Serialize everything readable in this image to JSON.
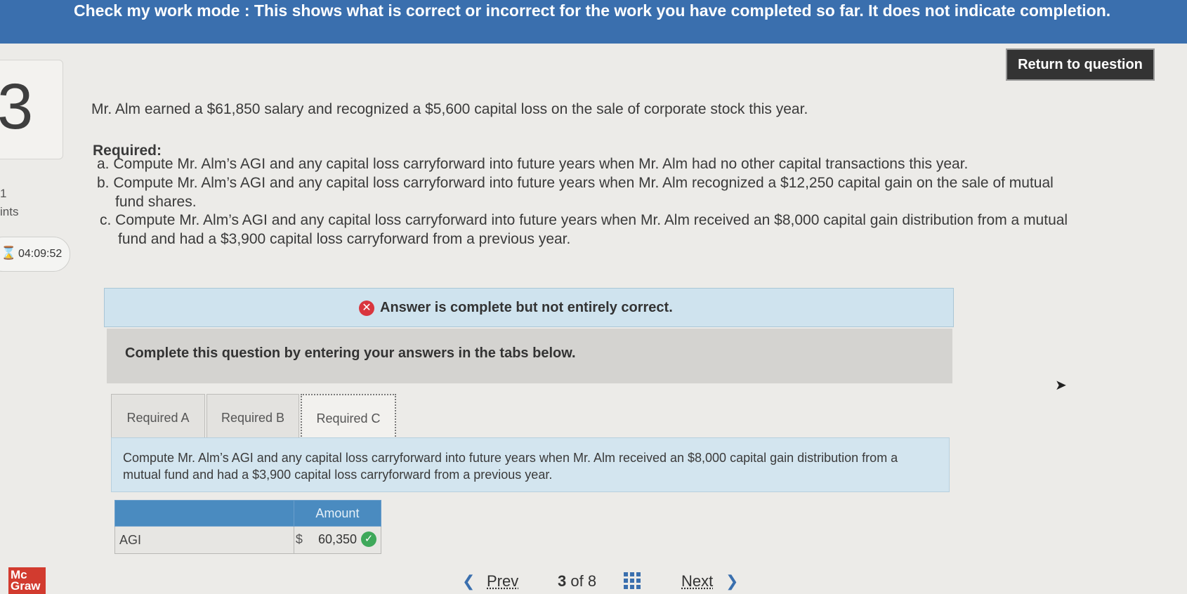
{
  "banner": {
    "text": "Check my work mode : This shows what is correct or incorrect for the work you have completed so far. It does not indicate completion."
  },
  "sidebar": {
    "question_number": "3",
    "points_value": "1",
    "points_label": "ints",
    "timer": "04:09:52"
  },
  "return_button": "Return to question",
  "question": {
    "intro": "Mr. Alm earned a $61,850 salary and recognized a $5,600 capital loss on the sale of corporate stock this year.",
    "required_title": "Required:",
    "items": [
      "a. Compute Mr. Alm’s AGI and any capital loss carryforward into future years when Mr. Alm had no other capital transactions this year.",
      "b. Compute Mr. Alm’s AGI and any capital loss carryforward into future years when Mr. Alm recognized a $12,250 capital gain on the sale of mutual fund shares.",
      "c. Compute Mr. Alm’s AGI and any capital loss carryforward into future years when Mr. Alm received an $8,000 capital gain distribution from a mutual fund and had a $3,900 capital loss carryforward from a previous year."
    ]
  },
  "status": {
    "text": "Answer is complete but not entirely correct."
  },
  "instructions": "Complete this question by entering your answers in the tabs below.",
  "tabs": [
    {
      "label": "Required A"
    },
    {
      "label": "Required B"
    },
    {
      "label": "Required C"
    }
  ],
  "active_tab": "Required C",
  "tab_description": "Compute Mr. Alm’s AGI and any capital loss carryforward into future years when Mr. Alm received an $8,000 capital gain distribution from a mutual fund and had a $3,900 capital loss carryforward from a previous year.",
  "answer_table": {
    "header_amount": "Amount",
    "rows": [
      {
        "label": "AGI",
        "currency": "$",
        "value": "60,350",
        "correct": true
      }
    ]
  },
  "footer": {
    "logo": "Mc Graw",
    "prev_label": "Prev",
    "page_current": "3",
    "page_of": "of",
    "page_total": "8",
    "next_label": "Next"
  },
  "colors": {
    "banner_bg": "#3a6fae",
    "status_bg": "#cfe3ee",
    "error_red": "#d9363e",
    "correct_green": "#3ea85a",
    "table_header": "#4a8bc0"
  }
}
